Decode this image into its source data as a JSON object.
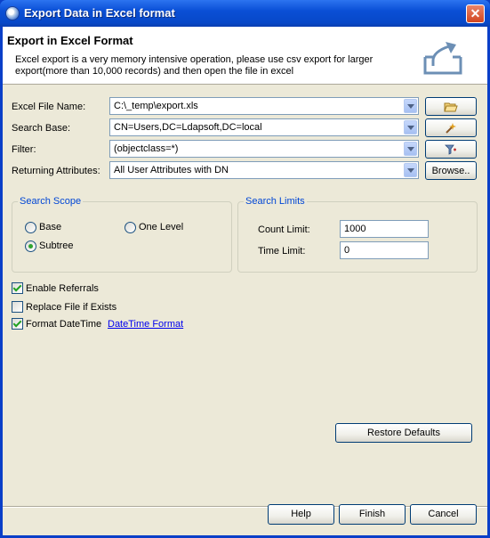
{
  "window": {
    "title": "Export Data in Excel format",
    "close_glyph": "✕"
  },
  "header": {
    "title": "Export in Excel Format",
    "description": "Excel export is a very memory intensive operation, please use csv export for larger export(more than 10,000 records) and then open the file in excel",
    "icon": "export-icon"
  },
  "fields": {
    "file_name_label": "Excel File Name:",
    "file_name_value": "C:\\_temp\\export.xls",
    "search_base_label": "Search Base:",
    "search_base_value": "CN=Users,DC=Ldapsoft,DC=local",
    "filter_label": "Filter:",
    "filter_value": "(objectclass=*)",
    "returning_label": "Returning Attributes:",
    "returning_value": "All User Attributes with DN",
    "browse_label": "Browse.."
  },
  "icons": {
    "folder": "folder-icon",
    "search_base": "wand-icon",
    "filter": "filter-icon"
  },
  "search_scope": {
    "title": "Search Scope",
    "options": [
      {
        "label": "Base",
        "selected": false
      },
      {
        "label": "One Level",
        "selected": false
      },
      {
        "label": "Subtree",
        "selected": true
      }
    ]
  },
  "search_limits": {
    "title": "Search Limits",
    "count_label": "Count Limit:",
    "count_value": "1000",
    "time_label": "Time Limit:",
    "time_value": "0"
  },
  "options": {
    "enable_referrals": {
      "label": "Enable Referrals",
      "checked": true
    },
    "replace_file": {
      "label": "Replace File if Exists",
      "checked": false
    },
    "format_datetime": {
      "label": "Format DateTime",
      "checked": true
    },
    "datetime_link": "DateTime Format"
  },
  "buttons": {
    "restore_defaults": "Restore Defaults",
    "help": "Help",
    "finish": "Finish",
    "cancel": "Cancel"
  },
  "colors": {
    "title_bar": "#0a4fd6",
    "group_title": "#0046d5",
    "link": "#0000ee",
    "face": "#ece9d8"
  }
}
